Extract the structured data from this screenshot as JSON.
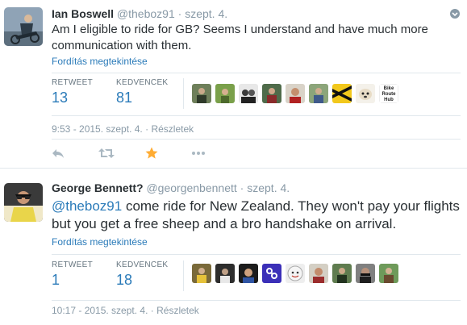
{
  "tweets": [
    {
      "fullname": "Ian Boswell",
      "handle": "@theboz91",
      "sep": "·",
      "time": "szept. 4.",
      "text": "Am I eligible to ride for GB? Seems I understand and have much more communication with them.",
      "translate": "Fordítás megtekintése",
      "retweet_label": "RETWEET",
      "retweet_count": "13",
      "favorite_label": "KEDVENCEK",
      "favorite_count": "81",
      "timestamp": "9:53 - 2015. szept. 4.",
      "details": "Részletek",
      "favorited": true,
      "bike_route_label": "Bike Route Hub"
    },
    {
      "fullname": "George Bennett?",
      "handle": "@georgenbennett",
      "sep": "·",
      "time": "szept. 4.",
      "mention": "@theboz91",
      "text": " come ride for New Zealand. They won't pay your flights but you get a free sheep and a bro handshake on arrival.",
      "translate": "Fordítás megtekintése",
      "retweet_label": "RETWEET",
      "retweet_count": "1",
      "favorite_label": "KEDVENCEK",
      "favorite_count": "18",
      "timestamp": "10:17 - 2015. szept. 4.",
      "details": "Részletek"
    }
  ],
  "colors": {
    "link": "#2b7bb9",
    "muted": "#8899a6",
    "fav_active": "#ffac33",
    "divider": "#e1e8ed"
  }
}
